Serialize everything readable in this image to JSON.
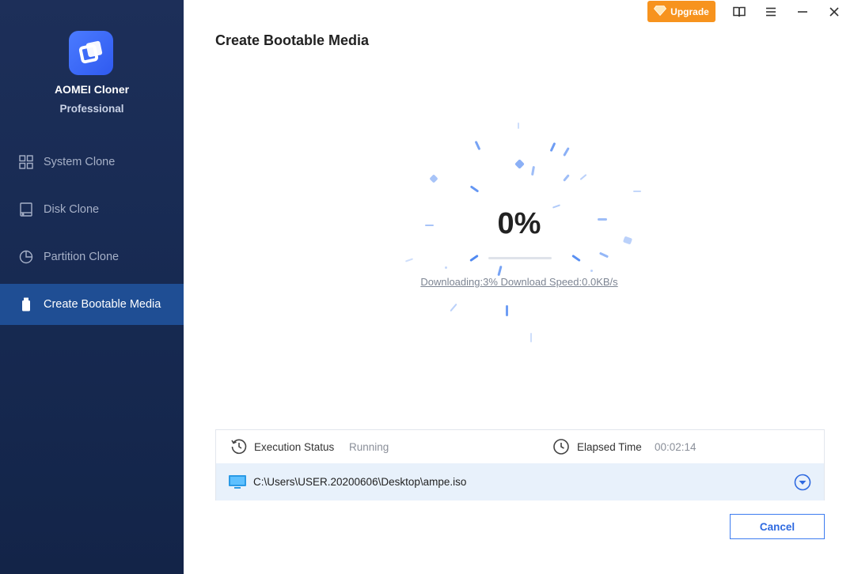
{
  "app": {
    "name": "AOMEI Cloner",
    "edition": "Professional"
  },
  "sidebar": {
    "items": [
      {
        "label": "System Clone",
        "icon": "grid-icon",
        "active": false
      },
      {
        "label": "Disk Clone",
        "icon": "disk-icon",
        "active": false
      },
      {
        "label": "Partition Clone",
        "icon": "pie-chart-icon",
        "active": false
      },
      {
        "label": "Create Bootable Media",
        "icon": "usb-drive-icon",
        "active": true
      }
    ]
  },
  "titlebar": {
    "upgrade_label": "Upgrade",
    "icons": [
      "book-icon",
      "menu-icon",
      "minimize-icon",
      "close-icon"
    ]
  },
  "main": {
    "title": "Create Bootable Media",
    "progress_percent_label": "0%",
    "progress_value": 0.0,
    "download_status": "Downloading:3% Download Speed:0.0KB/s"
  },
  "status": {
    "execution_label": "Execution Status",
    "execution_value": "Running",
    "elapsed_label": "Elapsed Time",
    "elapsed_value": "00:02:14",
    "file_path": "C:\\Users\\USER.20200606\\Desktop\\ampe.iso"
  },
  "buttons": {
    "cancel_label": "Cancel"
  },
  "colors": {
    "sidebar_bg": "#172a52",
    "active_item": "#1f4e94",
    "accent": "#3d7cf0",
    "upgrade": "#f7931e"
  }
}
